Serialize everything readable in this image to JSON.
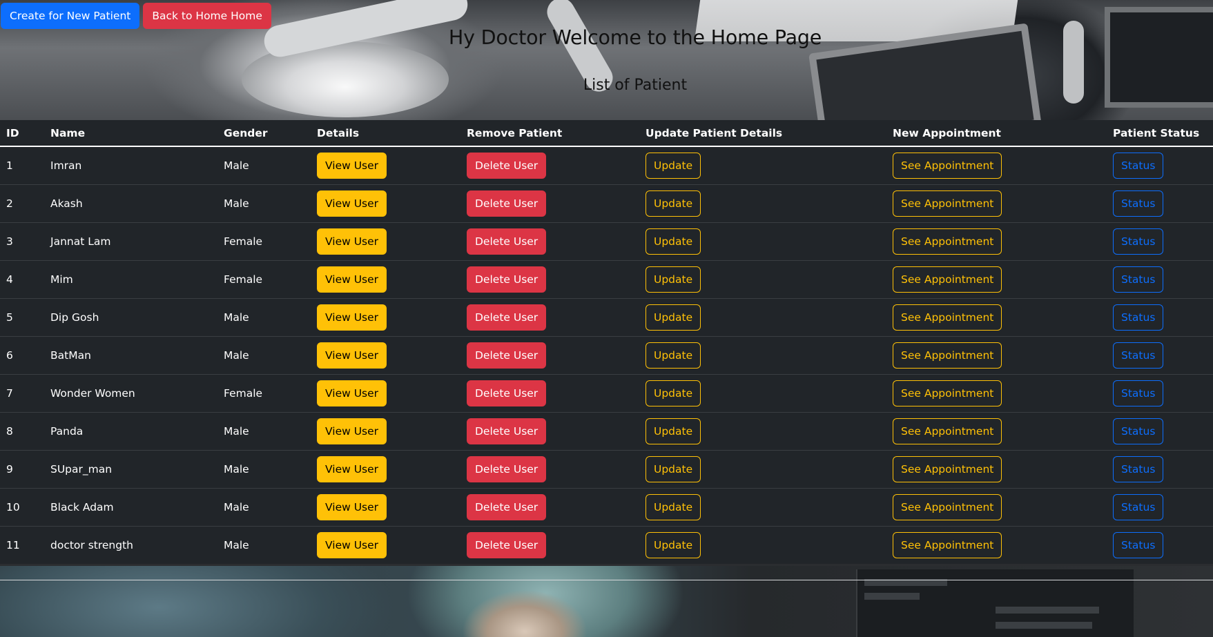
{
  "top_actions": {
    "create_label": "Create for New Patient",
    "back_label": "Back to Home Home"
  },
  "header": {
    "title": "Hy Doctor Welcome to the Home Page",
    "subtitle": "List of Patient"
  },
  "table": {
    "columns": [
      "ID",
      "Name",
      "Gender",
      "Details",
      "Remove Patient",
      "Update Patient Details",
      "New Appointment",
      "Patient Status"
    ],
    "actions": {
      "view": "View User",
      "delete": "Delete User",
      "update": "Update",
      "appointment": "See Appointment",
      "status": "Status"
    },
    "rows": [
      {
        "id": "1",
        "name": "Imran",
        "gender": "Male"
      },
      {
        "id": "2",
        "name": "Akash",
        "gender": "Male"
      },
      {
        "id": "3",
        "name": "Jannat Lam",
        "gender": "Female"
      },
      {
        "id": "4",
        "name": "Mim",
        "gender": "Female"
      },
      {
        "id": "5",
        "name": "Dip Gosh",
        "gender": "Male"
      },
      {
        "id": "6",
        "name": "BatMan",
        "gender": "Male"
      },
      {
        "id": "7",
        "name": "Wonder Women",
        "gender": "Female"
      },
      {
        "id": "8",
        "name": "Panda",
        "gender": "Male"
      },
      {
        "id": "9",
        "name": "SUpar_man",
        "gender": "Male"
      },
      {
        "id": "10",
        "name": "Black Adam",
        "gender": "Male"
      },
      {
        "id": "11",
        "name": "doctor strength",
        "gender": "Male"
      }
    ]
  },
  "colors": {
    "primary": "#0d6efd",
    "danger": "#dc3545",
    "warning": "#ffc107",
    "table_bg": "#212529"
  }
}
